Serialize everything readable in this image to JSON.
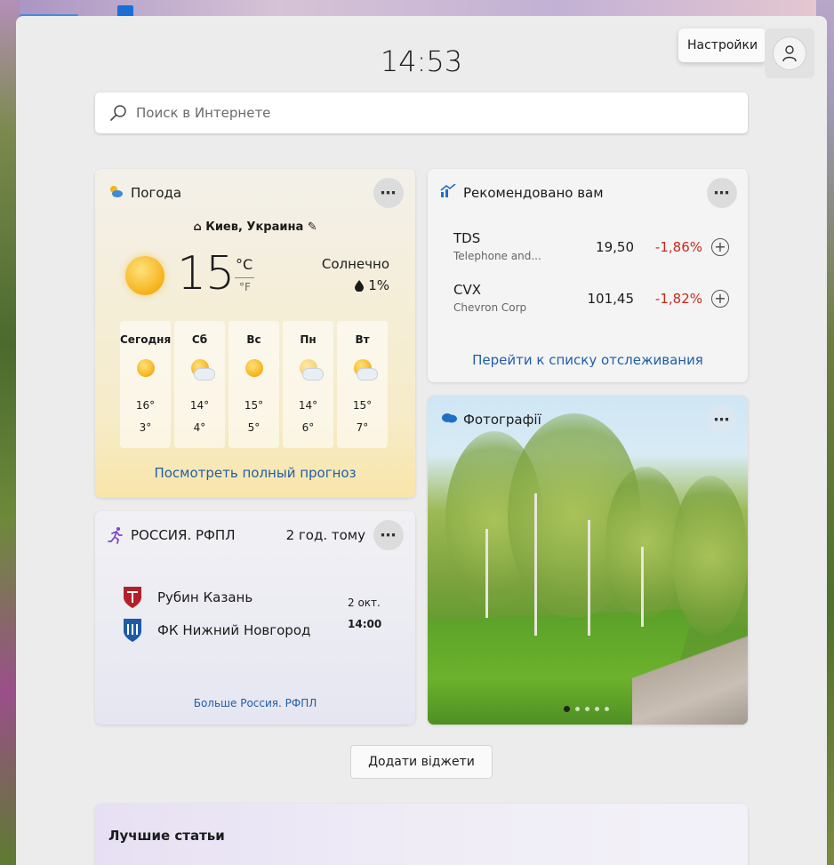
{
  "header": {
    "time": "14:53",
    "settings_tooltip": "Настройки"
  },
  "search": {
    "placeholder": "Поиск в Интернете"
  },
  "weather": {
    "title": "Погода",
    "location": "Киев, Украина",
    "temperature": "15",
    "unit_c": "°C",
    "unit_f": "°F",
    "condition": "Солнечно",
    "precipitation": "1%",
    "days": [
      {
        "name": "Сегодня",
        "icon": "sun-icon",
        "high": "16°",
        "low": "3°"
      },
      {
        "name": "Сб",
        "icon": "partly-cloudy-icon",
        "high": "14°",
        "low": "4°"
      },
      {
        "name": "Вс",
        "icon": "sun-icon",
        "high": "15°",
        "low": "5°"
      },
      {
        "name": "Пн",
        "icon": "cloudy-icon",
        "high": "14°",
        "low": "6°"
      },
      {
        "name": "Вт",
        "icon": "partly-cloudy-icon",
        "high": "15°",
        "low": "7°"
      }
    ],
    "forecast_link": "Посмотреть полный прогноз"
  },
  "stocks": {
    "title": "Рекомендовано вам",
    "items": [
      {
        "symbol": "TDS",
        "name": "Telephone and...",
        "price": "19,50",
        "change": "-1,86%"
      },
      {
        "symbol": "CVX",
        "name": "Chevron Corp",
        "price": "101,45",
        "change": "-1,82%"
      }
    ],
    "watchlist_link": "Перейти к списку отслеживания",
    "negative_color": "#c42b1c"
  },
  "photos": {
    "title": "Фотографії",
    "slide_count": 5,
    "active_slide": 1
  },
  "sports": {
    "title": "РОССИЯ. РФПЛ",
    "time_ago": "2 год. тому",
    "teams": [
      {
        "name": "Рубин Казань"
      },
      {
        "name": "ФК Нижний Новгород"
      }
    ],
    "date": "2 окт.",
    "time": "14:00",
    "more_link": "Больше Россия. РФПЛ"
  },
  "add_widgets_label": "Додати віджети",
  "top_stories": {
    "title": "Лучшие статьи"
  },
  "colors": {
    "link": "#1f5ea8",
    "panel": "#ececec"
  }
}
